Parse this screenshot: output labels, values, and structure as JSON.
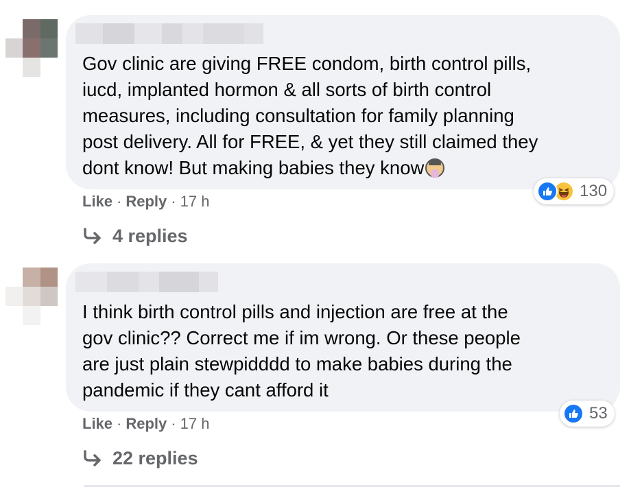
{
  "comments": [
    {
      "text_lines": [
        "Gov clinic are giving FREE condom, birth control pills,",
        "iucd, implanted hormon & all sorts of birth control",
        "measures, including consultation for family planning",
        "post delivery. All for FREE, & yet they still claimed they",
        "dont know! But making babies they know"
      ],
      "trailing_emoji": "woman-facepalming-icon",
      "reactions": {
        "types": [
          "like",
          "haha"
        ],
        "count": "130"
      },
      "actions": {
        "like": "Like",
        "reply": "Reply",
        "time": "17 h"
      },
      "replies_label": "4 replies"
    },
    {
      "text_lines": [
        "I think birth control pills and injection are free at the",
        "gov clinic?? Correct me if im wrong. Or these people",
        "are just plain stewpidddd to make babies during the",
        "pandemic if they cant afford it"
      ],
      "reactions": {
        "types": [
          "like"
        ],
        "count": "53"
      },
      "actions": {
        "like": "Like",
        "reply": "Reply",
        "time": "17 h"
      },
      "replies_label": "22 replies"
    }
  ],
  "separator": "·",
  "colors": {
    "bubble": "#f0f2f5",
    "secondary_text": "#65676b",
    "like_blue": "#1877f2",
    "haha_yellow": "#f7c33a"
  }
}
